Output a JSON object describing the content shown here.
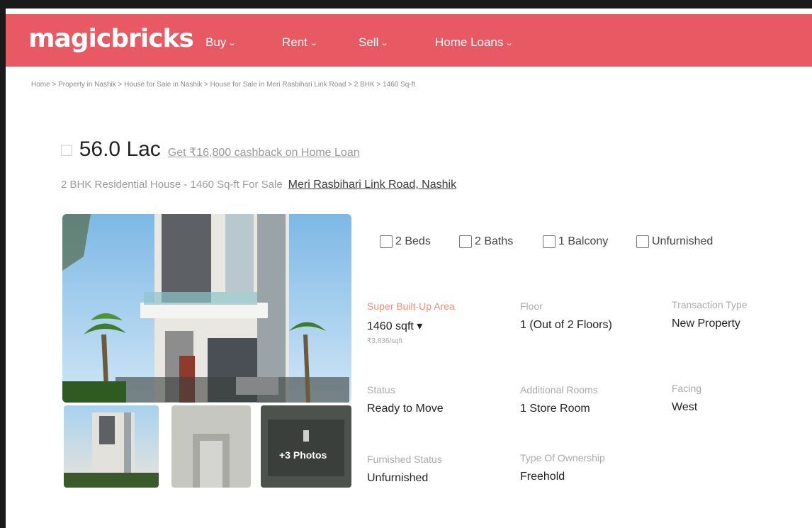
{
  "header": {
    "logo": "magicbricks",
    "nav": [
      {
        "label": "Buy"
      },
      {
        "label": "Rent"
      },
      {
        "label": "Sell"
      },
      {
        "label": "Home Loans"
      }
    ]
  },
  "breadcrumb": "Home > Property in Nashik > House for Sale in Nashik > House for Sale in Meri Rasbihari Link Road > 2 BHK > 1460 Sq-ft",
  "listing": {
    "price": "56.0 Lac",
    "cashback": "Get ₹16,800 cashback on Home Loan",
    "subtitle": "2 BHK Residential House - 1460 Sq-ft For Sale",
    "location": "Meri Rasbihari Link Road, Nashik",
    "photos_label": "+3 Photos"
  },
  "features": [
    {
      "icon": "bed-icon",
      "label": "2 Beds"
    },
    {
      "icon": "bath-icon",
      "label": "2 Baths"
    },
    {
      "icon": "balcony-icon",
      "label": "1 Balcony"
    },
    {
      "icon": "furnishing-icon",
      "label": "Unfurnished"
    }
  ],
  "specs": {
    "area": {
      "label": "Super Built-Up Area",
      "value": "1460 sqft",
      "sub": "₹3,836/sqft"
    },
    "floor": {
      "label": "Floor",
      "value": "1 (Out of 2 Floors)"
    },
    "transaction": {
      "label": "Transaction Type",
      "value": "New Property"
    },
    "status": {
      "label": "Status",
      "value": "Ready to Move"
    },
    "rooms": {
      "label": "Additional Rooms",
      "value": "1 Store Room"
    },
    "facing": {
      "label": "Facing",
      "value": "West"
    },
    "furnished": {
      "label": "Furnished Status",
      "value": "Unfurnished"
    },
    "ownership": {
      "label": "Type Of Ownership",
      "value": "Freehold"
    }
  },
  "colors": {
    "brand": "#e85a63",
    "accent": "#e8927a"
  }
}
